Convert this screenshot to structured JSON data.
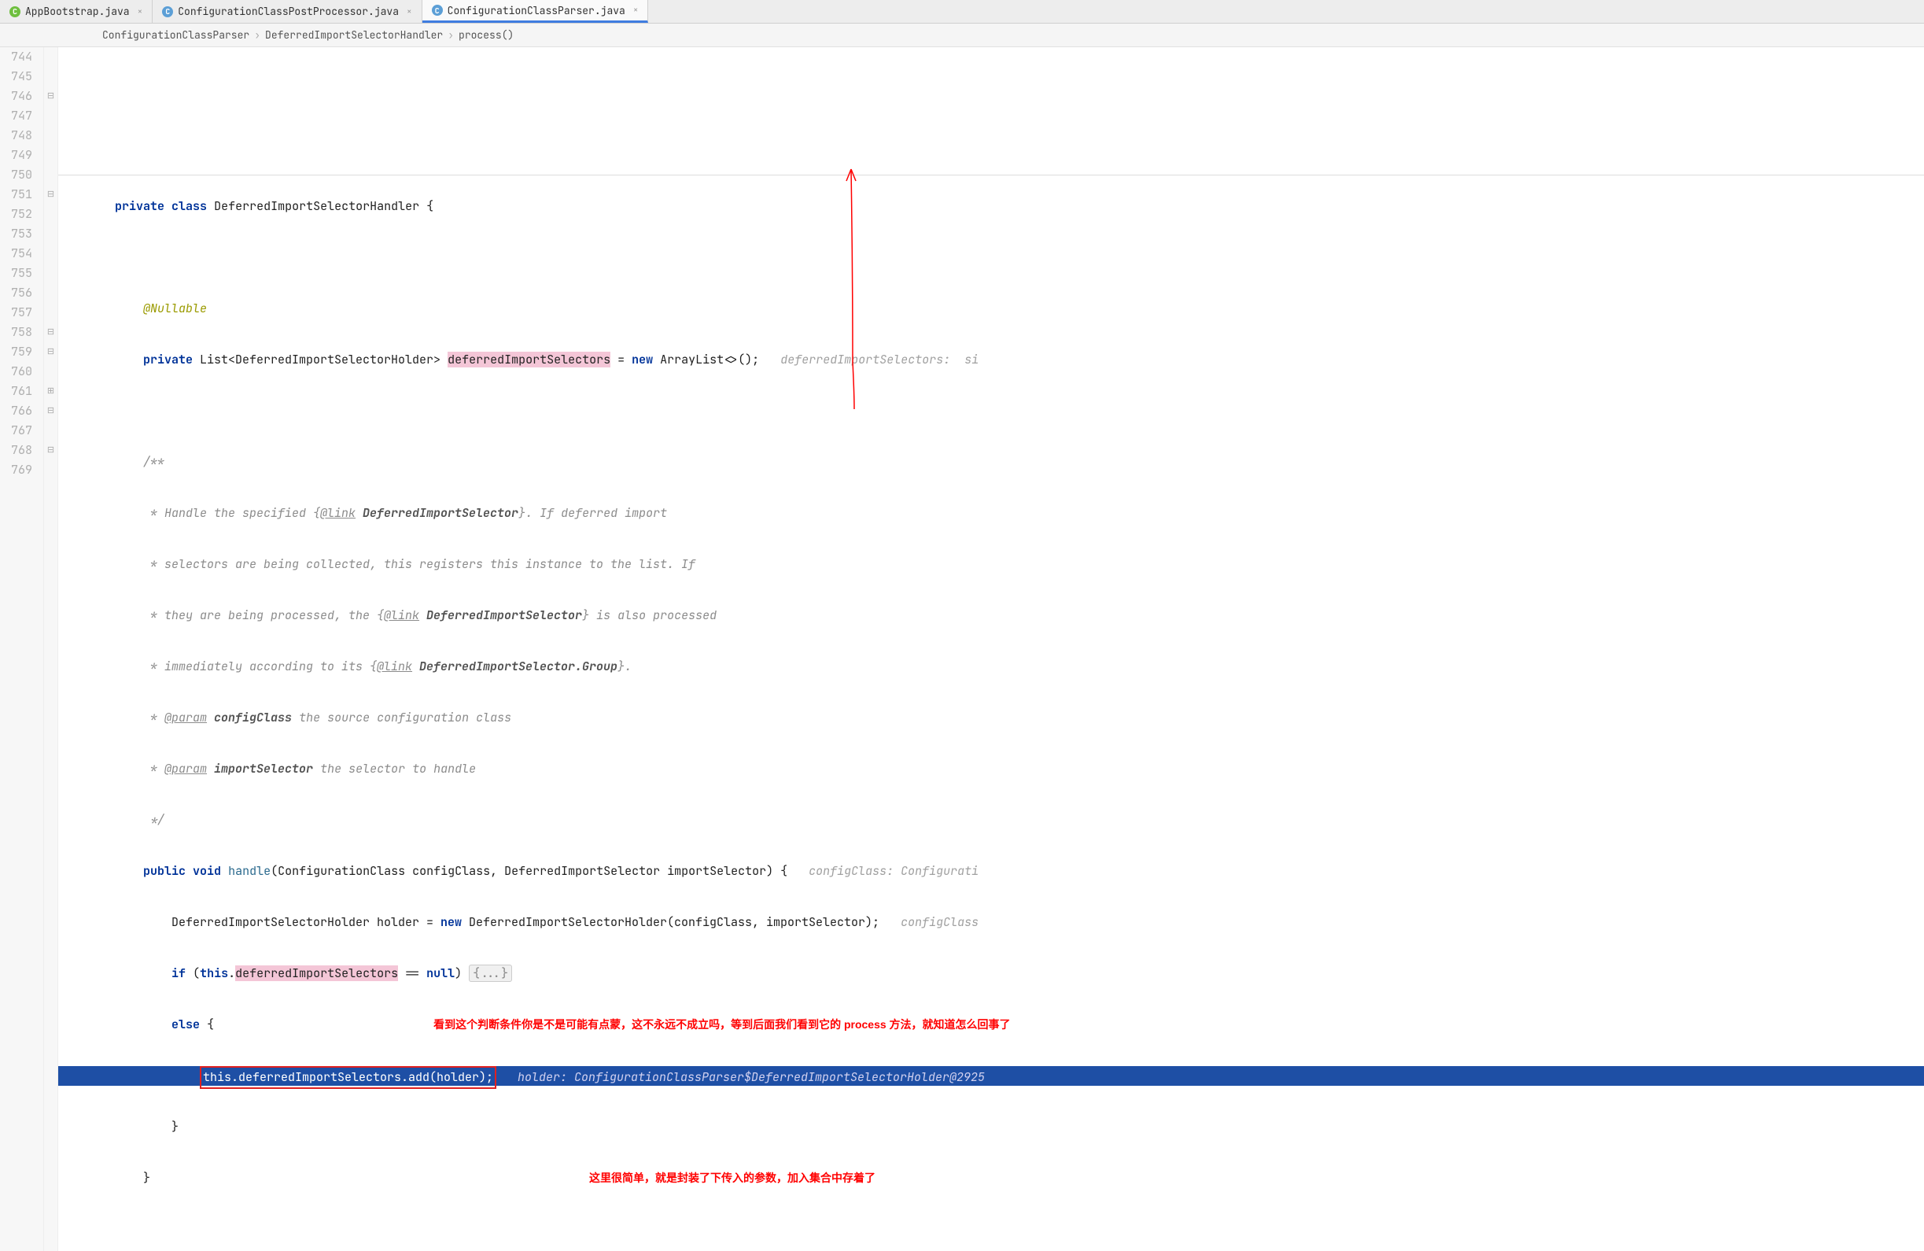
{
  "tabs": [
    {
      "icon": "C",
      "iconClass": "green",
      "label": "AppBootstrap.java",
      "closable": true,
      "active": false
    },
    {
      "icon": "C",
      "iconClass": "blue",
      "label": "ConfigurationClassPostProcessor.java",
      "closable": true,
      "active": false
    },
    {
      "icon": "C",
      "iconClass": "blue",
      "label": "ConfigurationClassParser.java",
      "closable": true,
      "active": true
    }
  ],
  "breadcrumb": {
    "parts": [
      "ConfigurationClassParser",
      "DeferredImportSelectorHandler",
      "process()"
    ],
    "sep": "›"
  },
  "lineNumbers": [
    "744",
    "745",
    "746",
    "747",
    "748",
    "749",
    "750",
    "751",
    "752",
    "753",
    "754",
    "755",
    "756",
    "757",
    "758",
    "759",
    "760",
    "761",
    "766",
    "767",
    "768",
    "769"
  ],
  "foldMarkers": [
    "",
    "",
    "⊟",
    "",
    "",
    "",
    "",
    "⊟",
    "",
    "",
    "",
    "",
    "",
    "",
    "⊟",
    "⊟",
    "",
    "⊞",
    "⊟",
    "",
    "⊟",
    ""
  ],
  "code": {
    "l746": {
      "kw1": "private",
      "kw2": "class",
      "className": "DeferredImportSelectorHandler {"
    },
    "l748": {
      "ann": "@Nullable"
    },
    "l749": {
      "kw1": "private",
      "type": "List<DeferredImportSelectorHolder>",
      "hlVar": "deferredImportSelectors",
      "eq": "=",
      "kw2": "new",
      "ctor": "ArrayList<>();",
      "hint": "deferredImportSelectors:  si"
    },
    "l751": {
      "txt": "/**"
    },
    "l752": {
      "pre": " * Handle the specified {",
      "tag": "@link",
      "b": " DeferredImportSelector",
      "post": "}. If deferred import"
    },
    "l753": {
      "txt": " * selectors are being collected, this registers this instance to the list. If"
    },
    "l754": {
      "pre": " * they are being processed, the {",
      "tag": "@link",
      "b": " DeferredImportSelector",
      "post": "} is also processed"
    },
    "l755": {
      "pre": " * immediately according to its {",
      "tag": "@link",
      "b": " DeferredImportSelector.Group",
      "post": "}."
    },
    "l756": {
      "pre": " * ",
      "tag": "@param",
      "b": " configClass",
      "post": " the source configuration class"
    },
    "l757": {
      "pre": " * ",
      "tag": "@param",
      "b": " importSelector",
      "post": " the selector to handle"
    },
    "l758": {
      "txt": " */"
    },
    "l759": {
      "kw1": "public",
      "kw2": "void",
      "m": "handle",
      "params": "(ConfigurationClass configClass, DeferredImportSelector importSelector) {",
      "hint": "configClass: Configurati"
    },
    "l760": {
      "txt": "DeferredImportSelectorHolder holder = ",
      "kw": "new",
      "ctor": " DeferredImportSelectorHolder(configClass, importSelector);",
      "hint": "configClass"
    },
    "l761": {
      "kw1": "if",
      "p1": "(",
      "kw2": "this",
      "dot": ".",
      "hl": "deferredImportSelectors",
      "cond": " == ",
      "kw3": "null",
      "p2": ")",
      "fold": "{...}"
    },
    "l766": {
      "kw1": "else",
      "brace": "{",
      "annot": "看到这个判断条件你是不是可能有点蒙，这不永远不成立吗，等到后面我们看到它的 process 方法，就知道怎么回事了"
    },
    "l767": {
      "redbox": "this.deferredImportSelectors.add(holder);",
      "hint": "holder: ConfigurationClassParser$DeferredImportSelectorHolder@2925"
    },
    "l768": {
      "brace": "}"
    },
    "l769": {
      "brace": "}",
      "annot": "这里很简单，就是封装了下传入的参数，加入集合中存着了"
    }
  }
}
